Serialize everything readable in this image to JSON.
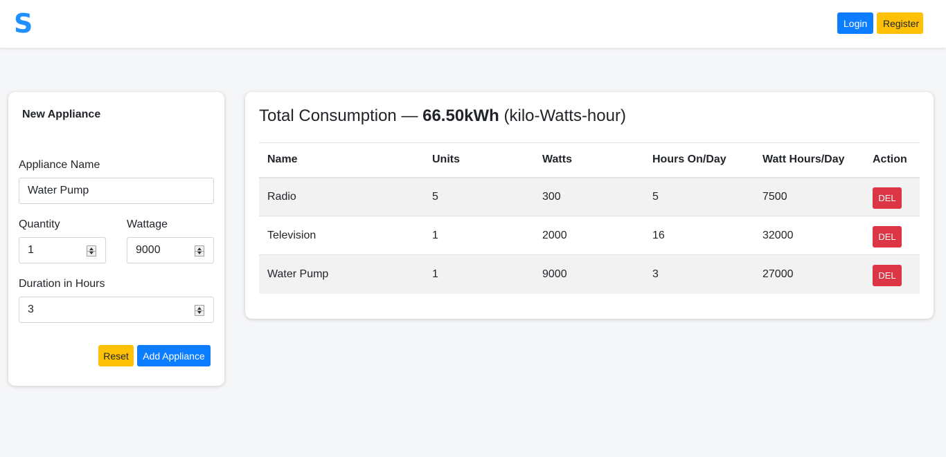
{
  "header": {
    "logo_text": "S",
    "login_label": "Login",
    "register_label": "Register"
  },
  "form": {
    "title": "New Appliance",
    "name_label": "Appliance Name",
    "name_value": "Water Pump",
    "quantity_label": "Quantity",
    "quantity_value": "1",
    "wattage_label": "Wattage",
    "wattage_value": "9000",
    "duration_label": "Duration in Hours",
    "duration_value": "3",
    "reset_label": "Reset",
    "add_label": "Add Appliance"
  },
  "summary": {
    "prefix": "Total Consumption — ",
    "total": "66.50kWh",
    "suffix": " (kilo-Watts-hour)"
  },
  "table": {
    "columns": [
      "Name",
      "Units",
      "Watts",
      "Hours On/Day",
      "Watt Hours/Day",
      "Action"
    ],
    "rows": [
      {
        "name": "Radio",
        "units": "5",
        "watts": "300",
        "hours": "5",
        "watt_hours": "7500",
        "action": "DEL"
      },
      {
        "name": "Television",
        "units": "1",
        "watts": "2000",
        "hours": "16",
        "watt_hours": "32000",
        "action": "DEL"
      },
      {
        "name": "Water Pump",
        "units": "1",
        "watts": "9000",
        "hours": "3",
        "watt_hours": "27000",
        "action": "DEL"
      }
    ]
  },
  "colors": {
    "primary": "#0d7dff",
    "warning": "#ffc107",
    "danger": "#dc3545",
    "logo": "#1e90ff"
  }
}
